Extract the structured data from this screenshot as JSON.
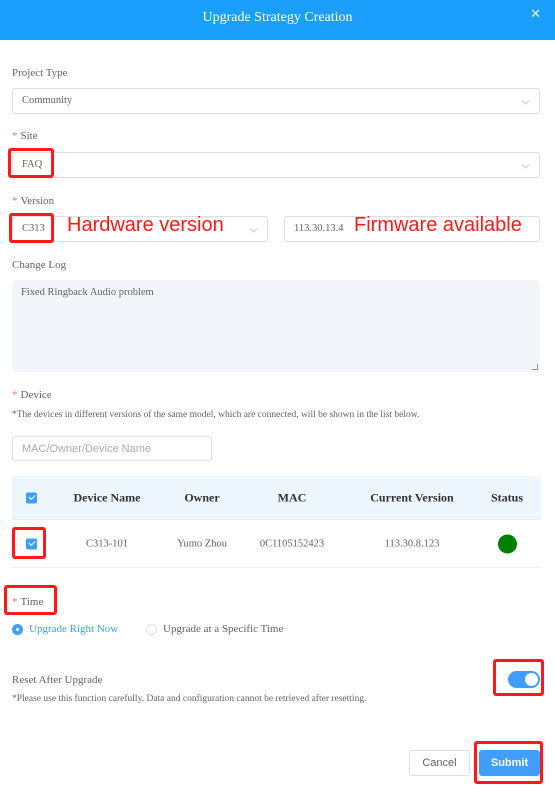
{
  "dialog": {
    "title": "Upgrade Strategy Creation",
    "close_icon": "close-icon"
  },
  "form": {
    "project_type": {
      "label": "Project Type",
      "value": "Community"
    },
    "site": {
      "label": "Site",
      "required_mark": "*",
      "value": "FAQ"
    },
    "version": {
      "label": "Version",
      "required_mark": "*",
      "hardware_value": "C313",
      "firmware_value": "113.30.13.4"
    },
    "change_log": {
      "label": "Change Log",
      "value": "Fixed Ringback Audio problem"
    },
    "device": {
      "label": "Device",
      "required_mark": "*",
      "hint": "*The devices in different versions of the same model, which are connected, will be shown in the list below.",
      "search_placeholder": "MAC/Owner/Device Name"
    },
    "table": {
      "header_checked": true,
      "columns": [
        "Device Name",
        "Owner",
        "MAC",
        "Current Version",
        "Status"
      ],
      "rows": [
        {
          "checked": true,
          "device_name": "C313-101",
          "owner": "Yumo Zhou",
          "mac": "0C1105152423",
          "current_version": "113.30.8.123",
          "status": "online",
          "status_color": "#008000"
        }
      ]
    },
    "time": {
      "label": "Time",
      "required_mark": "*",
      "options": [
        {
          "label": "Upgrade Right Now",
          "selected": true
        },
        {
          "label": "Upgrade at a Specific Time",
          "selected": false
        }
      ]
    },
    "reset": {
      "label": "Reset After Upgrade",
      "enabled": true,
      "hint": "*Please use this function carefully. Data and configuration cannot be retrieved after resetting."
    }
  },
  "footer": {
    "cancel_label": "Cancel",
    "submit_label": "Submit"
  },
  "annotations": {
    "hardware_label": "Hardware version",
    "firmware_label": "Firmware available",
    "color": "#ff1a1a"
  },
  "colors": {
    "header": "#1a9ffc",
    "primary": "#409eff",
    "required": "#f56c6c"
  }
}
